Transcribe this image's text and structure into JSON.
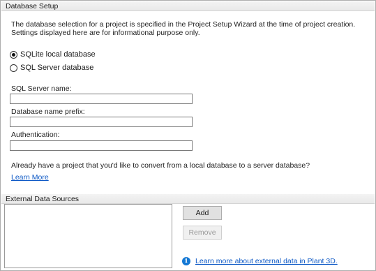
{
  "database_setup": {
    "header": "Database Setup",
    "description": "The database selection for a project is specified in the Project Setup Wizard at the time of project creation. Settings displayed here are for informational purpose only.",
    "options": [
      {
        "label": "SQLite local database",
        "selected": true
      },
      {
        "label": "SQL Server database",
        "selected": false
      }
    ],
    "server_name_label": "SQL Server name:",
    "server_name_value": "",
    "db_prefix_label": "Database name prefix:",
    "db_prefix_value": "",
    "auth_label": "Authentication:",
    "auth_value": "",
    "convert_question": "Already have a project that you'd like to convert from a local database to a server database?",
    "learn_more": "Learn More"
  },
  "external_data": {
    "header": "External Data Sources",
    "add_label": "Add",
    "remove_label": "Remove",
    "info_link": "Learn more about external data in Plant 3D."
  }
}
